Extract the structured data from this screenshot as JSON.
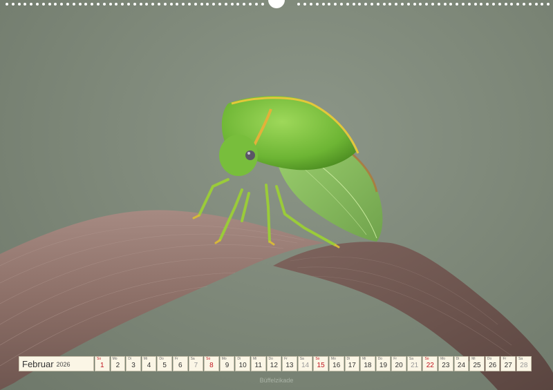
{
  "calendar": {
    "month": "Februar",
    "year": "2026",
    "days": [
      {
        "dow": "So",
        "num": "1",
        "type": "sun"
      },
      {
        "dow": "Mo",
        "num": "2",
        "type": "wk"
      },
      {
        "dow": "Di",
        "num": "3",
        "type": "wk"
      },
      {
        "dow": "Mi",
        "num": "4",
        "type": "wk"
      },
      {
        "dow": "Do",
        "num": "5",
        "type": "wk"
      },
      {
        "dow": "Fr",
        "num": "6",
        "type": "wk"
      },
      {
        "dow": "Sa",
        "num": "7",
        "type": "sat"
      },
      {
        "dow": "So",
        "num": "8",
        "type": "sun"
      },
      {
        "dow": "Mo",
        "num": "9",
        "type": "wk"
      },
      {
        "dow": "Di",
        "num": "10",
        "type": "wk"
      },
      {
        "dow": "Mi",
        "num": "11",
        "type": "wk"
      },
      {
        "dow": "Do",
        "num": "12",
        "type": "wk"
      },
      {
        "dow": "Fr",
        "num": "13",
        "type": "wk"
      },
      {
        "dow": "Sa",
        "num": "14",
        "type": "sat"
      },
      {
        "dow": "So",
        "num": "15",
        "type": "sun"
      },
      {
        "dow": "Mo",
        "num": "16",
        "type": "wk"
      },
      {
        "dow": "Di",
        "num": "17",
        "type": "wk"
      },
      {
        "dow": "Mi",
        "num": "18",
        "type": "wk"
      },
      {
        "dow": "Do",
        "num": "19",
        "type": "wk"
      },
      {
        "dow": "Fr",
        "num": "20",
        "type": "wk"
      },
      {
        "dow": "Sa",
        "num": "21",
        "type": "sat"
      },
      {
        "dow": "So",
        "num": "22",
        "type": "sun"
      },
      {
        "dow": "Mo",
        "num": "23",
        "type": "wk"
      },
      {
        "dow": "Di",
        "num": "24",
        "type": "wk"
      },
      {
        "dow": "Mi",
        "num": "25",
        "type": "wk"
      },
      {
        "dow": "Do",
        "num": "26",
        "type": "wk"
      },
      {
        "dow": "Fr",
        "num": "27",
        "type": "wk"
      },
      {
        "dow": "Sa",
        "num": "28",
        "type": "sat"
      }
    ]
  },
  "caption": "Büffelzikade",
  "colors": {
    "sunday": "#c0121d",
    "cell_bg": "#fbf6e6",
    "insect_green": "#7cc63a",
    "leaf_brown": "#8a6a60"
  }
}
